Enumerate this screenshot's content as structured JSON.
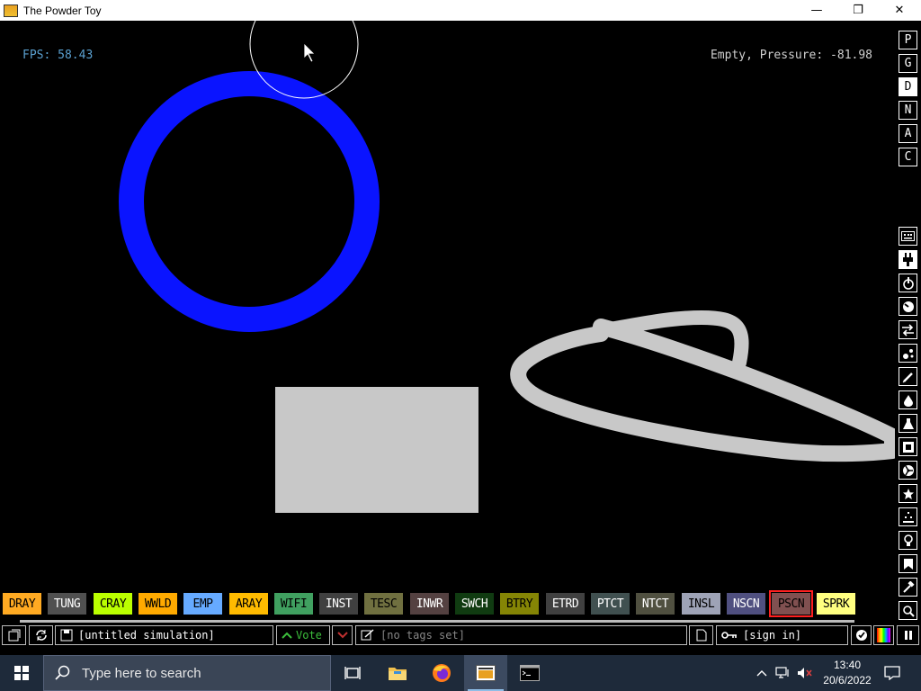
{
  "window": {
    "title": "The Powder Toy",
    "minimize": "—",
    "maximize": "❐",
    "close": "✕"
  },
  "hud": {
    "fps": "FPS: 58.43",
    "status": "Empty, Pressure: -81.98"
  },
  "right_panel": {
    "letters": [
      "P",
      "G",
      "D",
      "N",
      "A",
      "C"
    ],
    "active_letter": "D"
  },
  "elements": [
    {
      "label": "DRAY",
      "bg": "#ffaa22",
      "fg": "#000000"
    },
    {
      "label": "TUNG",
      "bg": "#505050",
      "fg": "#ffffff"
    },
    {
      "label": "CRAY",
      "bg": "#bbff00",
      "fg": "#000000"
    },
    {
      "label": "WWLD",
      "bg": "#ffaa00",
      "fg": "#000000"
    },
    {
      "label": "EMP",
      "bg": "#66aaff",
      "fg": "#000000"
    },
    {
      "label": "ARAY",
      "bg": "#ffbb00",
      "fg": "#000000"
    },
    {
      "label": "WIFI",
      "bg": "#40a060",
      "fg": "#000000"
    },
    {
      "label": "INST",
      "bg": "#404040",
      "fg": "#ffffff"
    },
    {
      "label": "TESC",
      "bg": "#707040",
      "fg": "#000000"
    },
    {
      "label": "INWR",
      "bg": "#544141",
      "fg": "#ffffff"
    },
    {
      "label": "SWCH",
      "bg": "#103b11",
      "fg": "#ffffff"
    },
    {
      "label": "BTRY",
      "bg": "#858505",
      "fg": "#000000"
    },
    {
      "label": "ETRD",
      "bg": "#404040",
      "fg": "#ffffff"
    },
    {
      "label": "PTCT",
      "bg": "#405050",
      "fg": "#ffffff"
    },
    {
      "label": "NTCT",
      "bg": "#505040",
      "fg": "#ffffff"
    },
    {
      "label": "INSL",
      "bg": "#9ea3b6",
      "fg": "#000000"
    },
    {
      "label": "NSCN",
      "bg": "#505080",
      "fg": "#ffffff"
    },
    {
      "label": "PSCN",
      "bg": "#805050",
      "fg": "#000000"
    },
    {
      "label": "SPRK",
      "bg": "#ffff80",
      "fg": "#000000"
    }
  ],
  "selected_element": "PSCN",
  "bottom_bar": {
    "save_name": "[untitled simulation]",
    "vote_label": "Vote",
    "tags": "[no tags set]",
    "sign_in": "[sign in]"
  },
  "taskbar": {
    "search_placeholder": "Type here to search",
    "time": "13:40",
    "date": "20/6/2022"
  },
  "colors": {
    "blue_ring": "#0a14ff",
    "drawn_powder": "#c8c8c8",
    "fps_text": "#5aa0d0",
    "vote_green": "#3cbf3c",
    "vote_red": "#c03030"
  }
}
